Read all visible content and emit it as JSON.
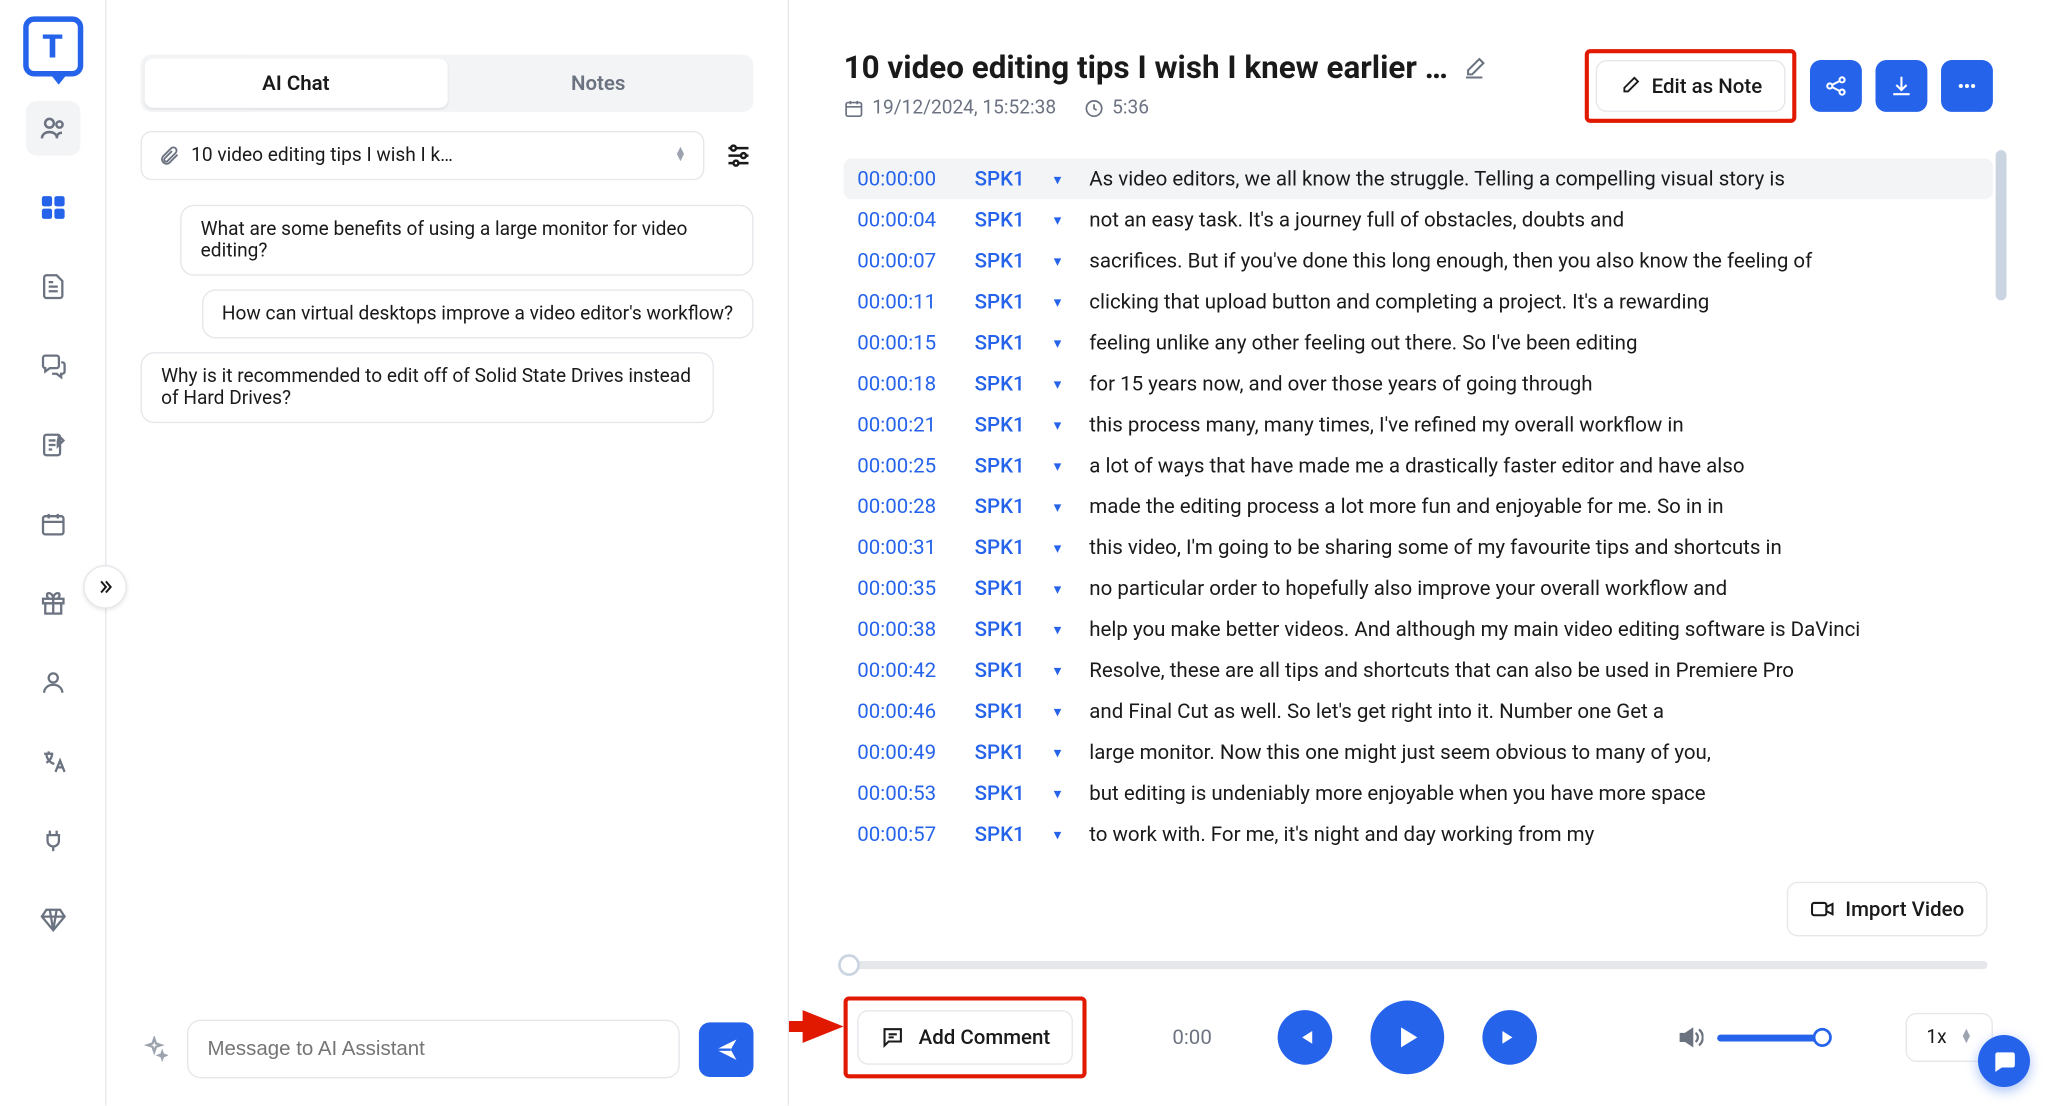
{
  "tabs": {
    "chat": "AI Chat",
    "notes": "Notes"
  },
  "file_selector": "10 video editing tips I wish I k…",
  "suggestions": [
    "What are some benefits of using a large monitor for video editing?",
    "How can virtual desktops improve a video editor's workflow?",
    "Why is it recommended to edit off of Solid State Drives instead of Hard Drives?"
  ],
  "chat_placeholder": "Message to AI Assistant",
  "title": "10 video editing tips I wish I knew earlier …",
  "meta": {
    "date": "19/12/2024, 15:52:38",
    "duration": "5:36"
  },
  "edit_note_label": "Edit as Note",
  "import_video_label": "Import Video",
  "add_comment_label": "Add Comment",
  "player": {
    "current_time": "0:00",
    "speed": "1x"
  },
  "transcript": [
    {
      "ts": "00:00:00",
      "spk": "SPK1",
      "text": "As video editors, we all know the struggle. Telling a compelling visual story is"
    },
    {
      "ts": "00:00:04",
      "spk": "SPK1",
      "text": "not an easy task. It's a journey full of obstacles, doubts and"
    },
    {
      "ts": "00:00:07",
      "spk": "SPK1",
      "text": "sacrifices. But if you've done this long enough, then you also know the feeling of"
    },
    {
      "ts": "00:00:11",
      "spk": "SPK1",
      "text": "clicking that upload button and completing a project. It's a rewarding"
    },
    {
      "ts": "00:00:15",
      "spk": "SPK1",
      "text": "feeling unlike any other feeling out there. So I've been editing"
    },
    {
      "ts": "00:00:18",
      "spk": "SPK1",
      "text": "for 15 years now, and over those years of going through"
    },
    {
      "ts": "00:00:21",
      "spk": "SPK1",
      "text": "this process many, many times, I've refined my overall workflow in"
    },
    {
      "ts": "00:00:25",
      "spk": "SPK1",
      "text": "a lot of ways that have made me a drastically faster editor and have also"
    },
    {
      "ts": "00:00:28",
      "spk": "SPK1",
      "text": "made the editing process a lot more fun and enjoyable for me. So in in"
    },
    {
      "ts": "00:00:31",
      "spk": "SPK1",
      "text": "this video, I'm going to be sharing some of my favourite tips and shortcuts in"
    },
    {
      "ts": "00:00:35",
      "spk": "SPK1",
      "text": "no particular order to hopefully also improve your overall workflow and"
    },
    {
      "ts": "00:00:38",
      "spk": "SPK1",
      "text": "help you make better videos. And although my main video editing software is DaVinci"
    },
    {
      "ts": "00:00:42",
      "spk": "SPK1",
      "text": "Resolve, these are all tips and shortcuts that can also be used in Premiere Pro"
    },
    {
      "ts": "00:00:46",
      "spk": "SPK1",
      "text": "and Final Cut as well. So let's get right into it. Number one Get a"
    },
    {
      "ts": "00:00:49",
      "spk": "SPK1",
      "text": "large monitor. Now this one might just seem obvious to many of you,"
    },
    {
      "ts": "00:00:53",
      "spk": "SPK1",
      "text": "but editing is undeniably more enjoyable when you have more space"
    },
    {
      "ts": "00:00:57",
      "spk": "SPK1",
      "text": "to work with. For me, it's night and day working from my"
    }
  ]
}
